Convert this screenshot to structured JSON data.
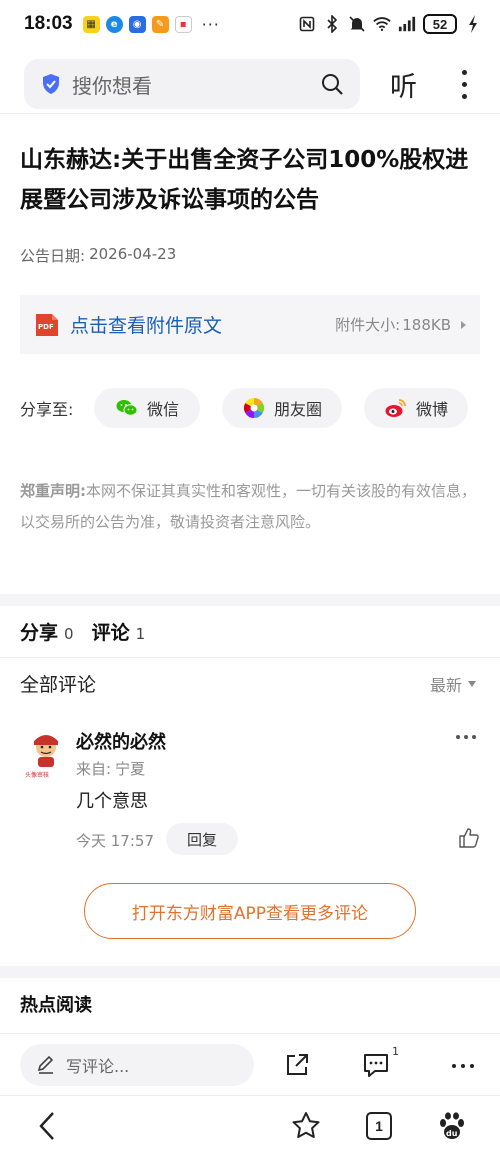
{
  "status_bar": {
    "time": "18:03",
    "battery": "52",
    "more": "···"
  },
  "search": {
    "placeholder": "搜你想看",
    "listen_label": "听"
  },
  "article": {
    "title": "山东赫达:关于出售全资子公司100%股权进展暨公司涉及诉讼事项的公告",
    "date_label": "公告日期:",
    "date_value": "2026-04-23"
  },
  "attachment": {
    "link_text": "点击查看附件原文",
    "size_label": "附件大小:",
    "size_value": "188KB"
  },
  "share": {
    "label": "分享至:",
    "targets": [
      {
        "label": "微信",
        "icon": "wechat-icon"
      },
      {
        "label": "朋友圈",
        "icon": "moments-icon"
      },
      {
        "label": "微博",
        "icon": "weibo-icon"
      }
    ]
  },
  "disclaimer": {
    "title": "郑重声明:",
    "text": "本网不保证其真实性和客观性，一切有关该股的有效信息，以交易所的公告为准，敬请投资者注意风险。"
  },
  "tabs": [
    {
      "label": "分享",
      "count": "0"
    },
    {
      "label": "评论",
      "count": "1"
    }
  ],
  "comments_section": {
    "header": "全部评论",
    "sort_label": "最新"
  },
  "comment": {
    "username": "必然的必然",
    "from_label": "来自:",
    "from_value": "宁夏",
    "body": "几个意思",
    "time": "今天 17:57",
    "reply_label": "回复",
    "avatar_caption": "头像审核"
  },
  "open_app_button": "打开东方财富APP查看更多评论",
  "hot_reading_title": "热点阅读",
  "toolbar": {
    "comment_placeholder": "写评论...",
    "comment_badge": "1"
  },
  "nav": {
    "tab_count": "1"
  },
  "colors": {
    "accent_orange": "#e4722b",
    "link_blue": "#1a5fb4",
    "pdf_red": "#e0442a"
  }
}
